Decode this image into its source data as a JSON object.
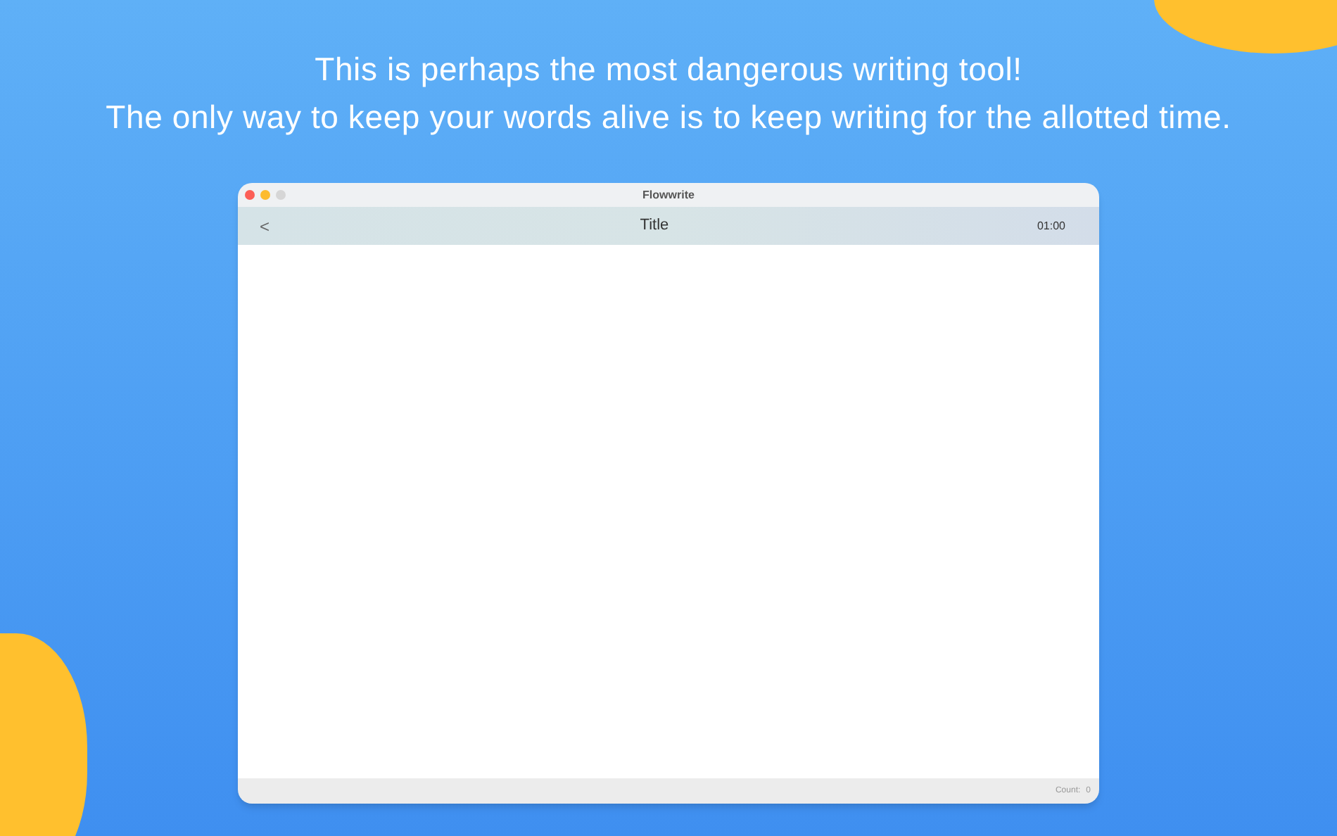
{
  "headline": [
    "This is perhaps the most dangerous writing tool!",
    "The only way to keep your words alive is to keep writing for the allotted time."
  ],
  "window": {
    "title": "Flowwrite"
  },
  "toolbar": {
    "back": "<",
    "title": "Title",
    "timer": "01:00"
  },
  "status_bar": {
    "count_label": "Count:",
    "count": "0"
  }
}
